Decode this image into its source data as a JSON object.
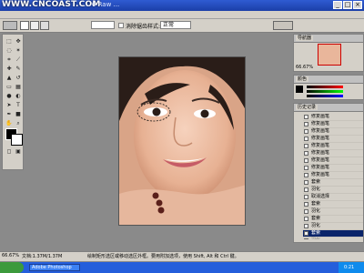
{
  "watermark": "WWW.CNCOAST.COM",
  "window": {
    "title_visible": "... 6 Raw ...",
    "buttons": [
      "_",
      "□",
      "×"
    ]
  },
  "options_bar": {
    "label_style": "样式:",
    "style_value": "正常",
    "checkbox_label": "消除锯齿"
  },
  "navigator": {
    "tab": "导航器",
    "zoom": "66.67%"
  },
  "color_panel": {
    "tab": "颜色"
  },
  "history": {
    "tab": "历史记录",
    "items": [
      {
        "label": "修复画笔",
        "state": "normal"
      },
      {
        "label": "修复画笔",
        "state": "normal"
      },
      {
        "label": "修复画笔",
        "state": "normal"
      },
      {
        "label": "修复画笔",
        "state": "normal"
      },
      {
        "label": "修复画笔",
        "state": "normal"
      },
      {
        "label": "修复画笔",
        "state": "normal"
      },
      {
        "label": "修复画笔",
        "state": "normal"
      },
      {
        "label": "修复画笔",
        "state": "normal"
      },
      {
        "label": "修复画笔",
        "state": "normal"
      },
      {
        "label": "套索",
        "state": "normal"
      },
      {
        "label": "羽化",
        "state": "normal"
      },
      {
        "label": "取消选择",
        "state": "normal"
      },
      {
        "label": "套索",
        "state": "normal"
      },
      {
        "label": "羽化",
        "state": "normal"
      },
      {
        "label": "套索",
        "state": "normal"
      },
      {
        "label": "羽化",
        "state": "normal"
      },
      {
        "label": "套索",
        "state": "active"
      },
      {
        "label": "羽化",
        "state": "dim"
      },
      {
        "label": "取消选择",
        "state": "dim"
      }
    ]
  },
  "status_bar": {
    "zoom": "66.67%",
    "doc": "文档:1.37M/1.37M",
    "hint": "绘制矩形选区或移动选区外框。要用附加选项，使用 Shift, Alt 和 Ctrl 键。"
  },
  "taskbar": {
    "task_label": "Adobe Photoshop",
    "clock": "0:21"
  },
  "colors": {
    "chrome": "#d4d0c8",
    "workspace": "#8a8a8a",
    "selection": "#0a246a",
    "taskbar": "#245edb"
  }
}
